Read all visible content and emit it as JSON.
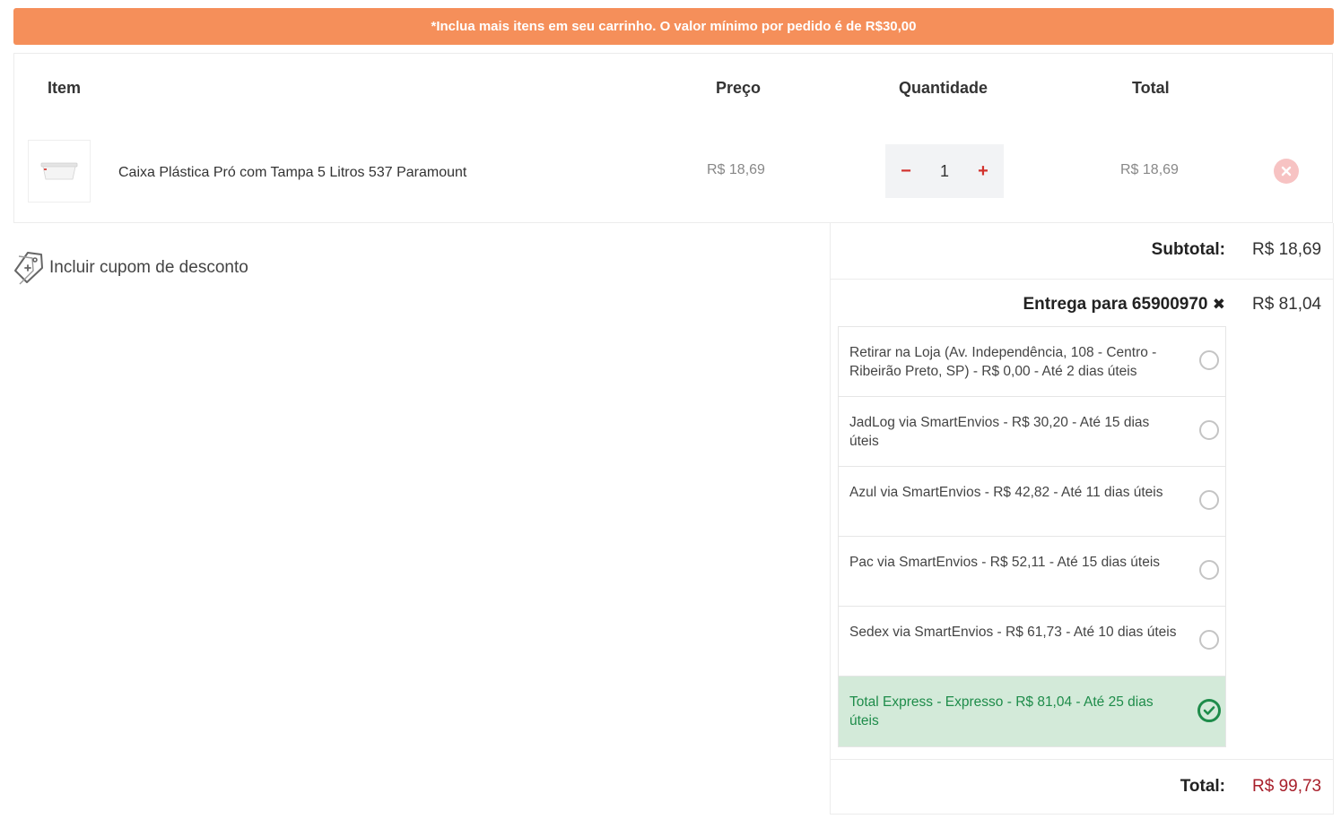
{
  "banner": {
    "text": "*Inclua mais itens em seu carrinho. O valor mínimo por pedido é de R$30,00"
  },
  "cart": {
    "headers": {
      "item": "Item",
      "price": "Preço",
      "quantity": "Quantidade",
      "total": "Total"
    },
    "items": [
      {
        "name": "Caixa Plástica Pró com Tampa 5 Litros 537 Paramount",
        "price": "R$ 18,69",
        "quantity": "1",
        "total": "R$ 18,69",
        "decrement_label": "−",
        "increment_label": "+"
      }
    ]
  },
  "coupon": {
    "label": "Incluir cupom de desconto"
  },
  "summary": {
    "subtotal_label": "Subtotal:",
    "subtotal_value": "R$ 18,69",
    "shipping_label": "Entrega para 65900970",
    "shipping_clear": "✖",
    "shipping_value": "R$ 81,04",
    "options": [
      {
        "label": "Retirar na Loja (Av. Independência, 108 - Centro - Ribeirão Preto, SP) - R$ 0,00 - Até 2 dias úteis",
        "selected": false
      },
      {
        "label": "JadLog via SmartEnvios - R$ 30,20 - Até 15 dias úteis",
        "selected": false
      },
      {
        "label": "Azul via SmartEnvios - R$ 42,82 - Até 11 dias úteis",
        "selected": false
      },
      {
        "label": "Pac via SmartEnvios - R$ 52,11 - Até 15 dias úteis",
        "selected": false
      },
      {
        "label": "Sedex via SmartEnvios - R$ 61,73 - Até 10 dias úteis",
        "selected": false
      },
      {
        "label": "Total Express - Expresso - R$ 81,04 - Até 25 dias úteis",
        "selected": true
      }
    ],
    "total_label": "Total:",
    "total_value": "R$ 99,73"
  },
  "colors": {
    "banner": "#f58f5a",
    "accent_minus_plus": "#d2322d",
    "selected_bg": "#d3ead9",
    "selected_text": "#1e8c4a",
    "total_value": "#a8202c"
  },
  "icons": {
    "remove": "close-circle-icon",
    "coupon": "tag-icon",
    "selected": "check-circle-icon"
  }
}
